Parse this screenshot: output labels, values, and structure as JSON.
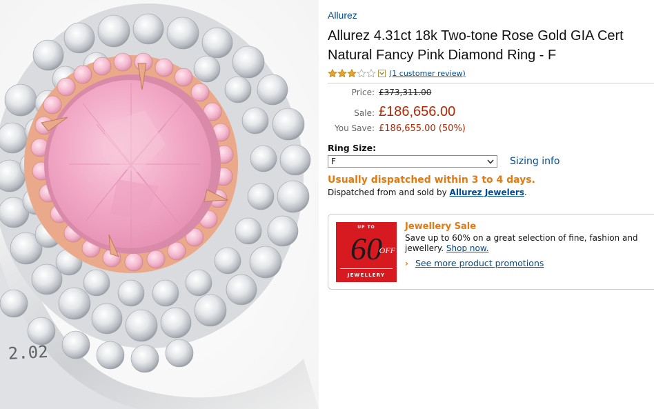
{
  "product": {
    "brand": "Allurez",
    "title_line1": "Allurez 4.31ct 18k Two-tone Rose Gold GIA Cert",
    "title_line2": "Natural Fancy Pink Diamond Ring - F",
    "rating": 3.0,
    "rating_max": 5,
    "review_link": "(1 customer review)",
    "image_engraving": "2.02"
  },
  "pricing": {
    "price_label": "Price:",
    "price_value": "£373,311.00",
    "sale_label": "Sale:",
    "sale_value": "£186,656.00",
    "save_label": "You Save:",
    "save_value": "£186,655.00 (50%)"
  },
  "options": {
    "ring_size_label": "Ring Size:",
    "ring_size_selected": "F",
    "sizing_link": "Sizing info"
  },
  "shipping": {
    "availability": "Usually dispatched within 3 to 4 days.",
    "sold_by_prefix": "Dispatched from and sold by ",
    "seller": "Allurez Jewelers",
    "sold_by_suffix": "."
  },
  "promo": {
    "badge_upto": "UP TO",
    "badge_percent": "60",
    "badge_off": "OFF",
    "badge_category": "JEWELLERY",
    "title": "Jewellery Sale",
    "body_line1": "Save up to 60% on a great selection of fine, fashion and",
    "body_line2_prefix": "jewellery. ",
    "shop_link": "Shop now.",
    "more_arrow": "›",
    "more_link": "See more product promotions"
  },
  "colors": {
    "link": "#004b91",
    "price_red": "#b12704",
    "orange": "#e47911",
    "star": "#e7a42b",
    "badge_red": "#d71920",
    "pink_stone": "#f2a6c4",
    "rose_gold": "#e9a98a"
  },
  "icons": [
    "star-icon",
    "chevron-down-icon",
    "dropdown-arrow-icon"
  ]
}
